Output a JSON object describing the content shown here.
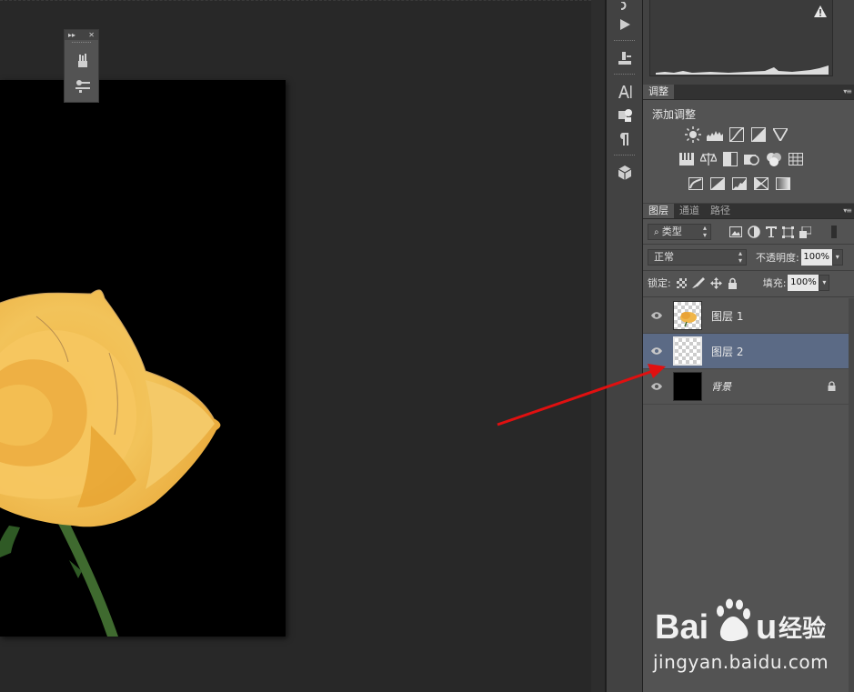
{
  "panels": {
    "adjustments": {
      "tab_label": "调整",
      "title": "添加调整"
    },
    "layers": {
      "tabs": [
        {
          "label": "图层",
          "active": true
        },
        {
          "label": "通道",
          "active": false
        },
        {
          "label": "路径",
          "active": false
        }
      ],
      "filter_kind": "类型",
      "blend_mode": "正常",
      "opacity_label": "不透明度:",
      "opacity_value": "100%",
      "lock_label": "锁定:",
      "fill_label": "填充:",
      "fill_value": "100%",
      "items": [
        {
          "name": "图层 1",
          "visible": true,
          "selected": false,
          "thumbnail": "rose"
        },
        {
          "name": "图层 2",
          "visible": true,
          "selected": true,
          "thumbnail": "transparent"
        },
        {
          "name": "背景",
          "visible": true,
          "selected": false,
          "thumbnail": "black",
          "locked": true
        }
      ]
    }
  },
  "watermark": {
    "url": "jingyan.baidu.com"
  },
  "colors": {
    "workspace_bg": "#282828",
    "panel_bg": "#535353",
    "selected_layer": "#5b6a85",
    "annotation_arrow": "#e01010"
  },
  "icons": [
    "histogram-warning-icon",
    "play-icon",
    "brush-settings-icon",
    "character-icon",
    "paragraph-icon",
    "3d-icon",
    "eye-icon",
    "lock-icon"
  ]
}
